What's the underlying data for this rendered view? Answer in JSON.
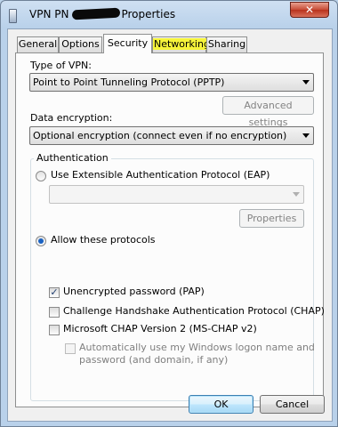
{
  "window": {
    "title_start": "VPN PN",
    "title_end": "Properties",
    "close_glyph": "✕"
  },
  "tabs": [
    {
      "label": "General"
    },
    {
      "label": "Options"
    },
    {
      "label": "Security",
      "active": true
    },
    {
      "label": "Networking",
      "highlighted": true
    },
    {
      "label": "Sharing"
    }
  ],
  "security": {
    "vpn_type_label": "Type of VPN:",
    "vpn_type_value": "Point to Point Tunneling Protocol (PPTP)",
    "advanced_settings_label": "Advanced settings",
    "encryption_label": "Data encryption:",
    "encryption_value": "Optional encryption (connect even if no encryption)",
    "auth_group_title": "Authentication",
    "eap_label": "Use Extensible Authentication Protocol (EAP)",
    "eap_selected": false,
    "eap_combo_value": "",
    "properties_label": "Properties",
    "allow_label": "Allow these protocols",
    "allow_selected": true,
    "protocols": [
      {
        "label": "Unencrypted password (PAP)",
        "checked": true
      },
      {
        "label": "Challenge Handshake Authentication Protocol (CHAP)",
        "checked": false
      },
      {
        "label": "Microsoft CHAP Version 2 (MS-CHAP v2)",
        "checked": false
      }
    ],
    "auto_logon_line1": "Automatically use my Windows logon name and",
    "auto_logon_line2": "password (and domain, if any)",
    "auto_logon_checked": false
  },
  "footer": {
    "ok_label": "OK",
    "cancel_label": "Cancel"
  },
  "colors": {
    "title_bar": "#bcd3ea",
    "close_button": "#c74b35",
    "tab_highlight": "#f6f43a",
    "radio_dot": "#1a62c2",
    "default_button_border": "#3c7fb1"
  }
}
